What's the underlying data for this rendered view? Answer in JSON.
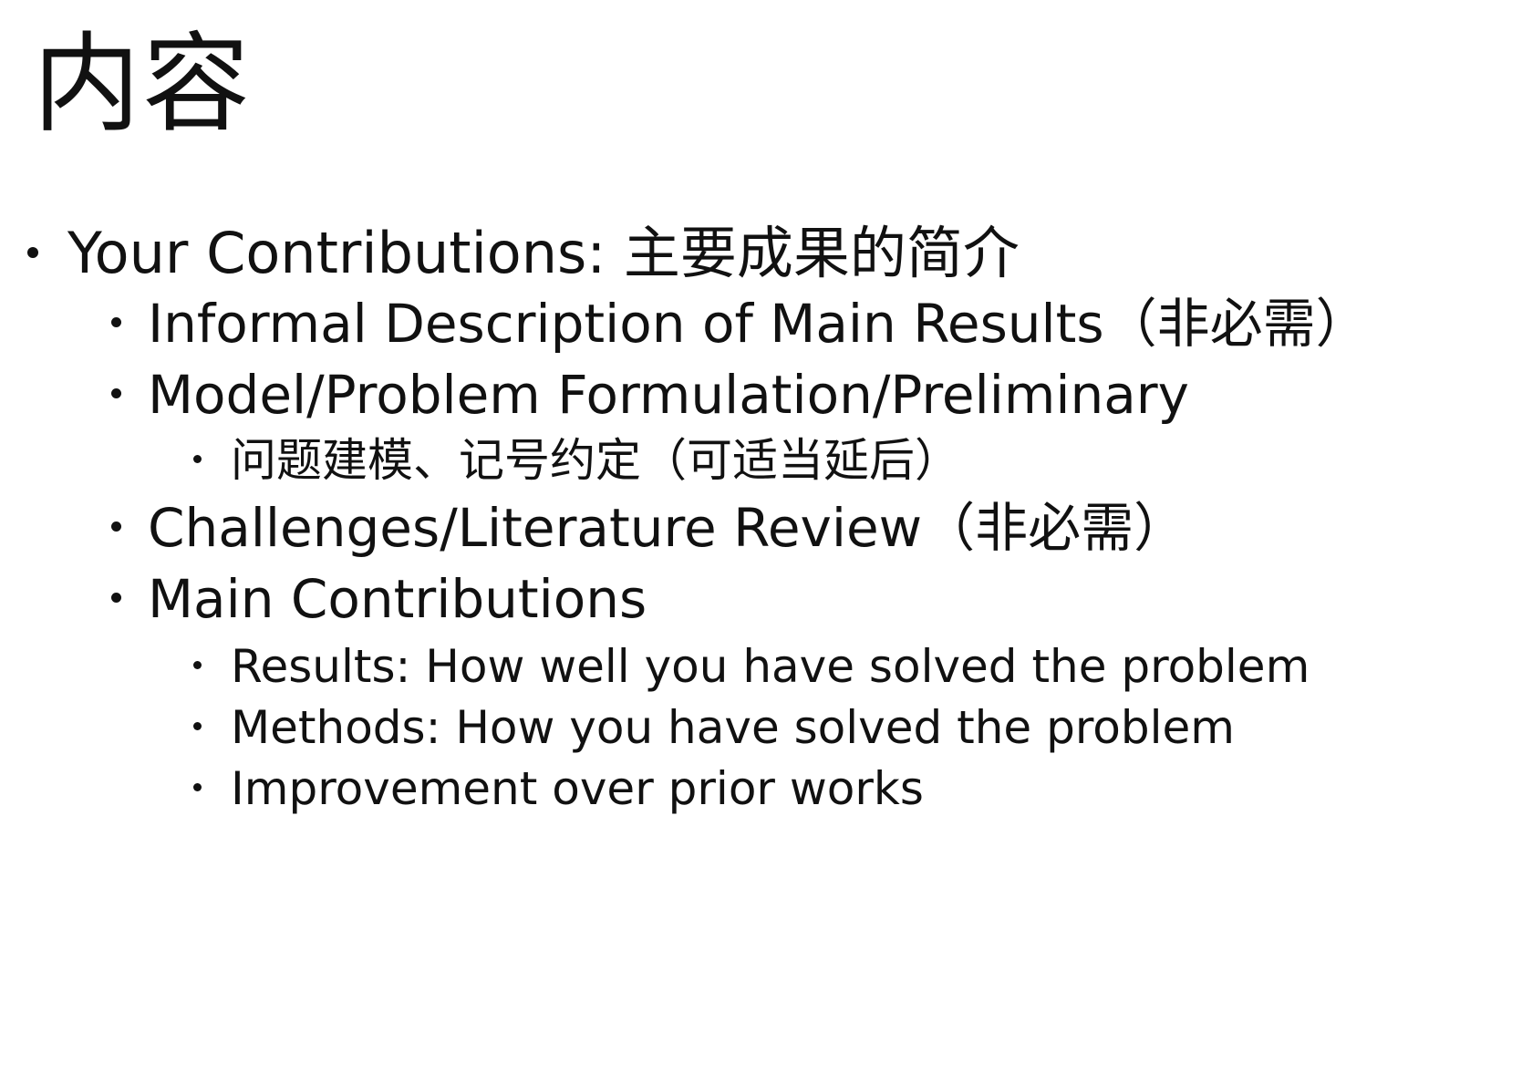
{
  "slide": {
    "title": "内容",
    "items": [
      {
        "level": 1,
        "text": "Your Contributions: 主要成果的简介"
      },
      {
        "level": 2,
        "text": "Informal Description of Main Results（非必需）"
      },
      {
        "level": 2,
        "text": "Model/Problem Formulation/Preliminary"
      },
      {
        "level": 3,
        "text": "问题建模、记号约定（可适当延后）"
      },
      {
        "level": 2,
        "text": "Challenges/Literature Review（非必需）"
      },
      {
        "level": 2,
        "text": "Main Contributions"
      },
      {
        "level": 3,
        "text": "Results: How well you have solved the problem"
      },
      {
        "level": 3,
        "text": "Methods: How you have solved the problem"
      },
      {
        "level": 3,
        "text": "Improvement over prior works"
      }
    ]
  }
}
